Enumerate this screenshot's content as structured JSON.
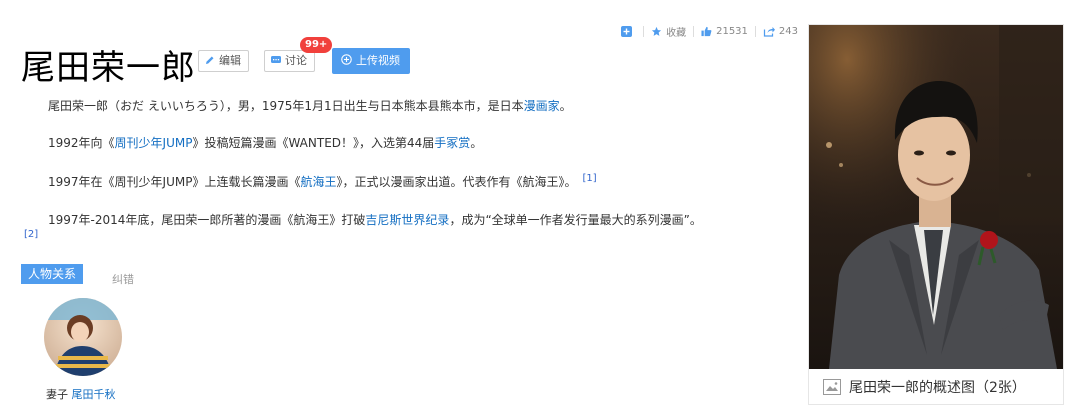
{
  "entry": {
    "title": "尾田荣一郎",
    "edit_label": "编辑",
    "discuss_label": "讨论",
    "discuss_badge": "99+",
    "upload_label": "上传视频"
  },
  "toolbar": {
    "favorite_label": "收藏",
    "likes": "21531",
    "shares": "243"
  },
  "paragraphs": {
    "p1_text": "尾田荣一郎（おだ えいいちろう），男，1975年1月1日出生与日本熊本县熊本市，是日本",
    "p1_link": "漫画家",
    "p1_end": "。",
    "p2_pre": "1992年向《",
    "p2_link1": "周刊少年JUMP",
    "p2_mid": "》投稿短篇漫画《WANTED！》，入选第44届",
    "p2_link2": "手冢赏",
    "p2_end": "。",
    "p3_pre": "1997年在《周刊少年JUMP》上连载长篇漫画《",
    "p3_link": "航海王",
    "p3_end": "》，正式以漫画家出道。代表作有《航海王》。",
    "p3_ref": "[1]",
    "p4_pre": "1997年-2014年底，尾田荣一郎所著的漫画《航海王》打破",
    "p4_link": "吉尼斯世界纪录",
    "p4_end": "，成为“全球单一作者发行量最大的系列漫画”。",
    "p4_ref": "[2]"
  },
  "relations": {
    "tag_label": "人物关系",
    "correct_label": "纠错",
    "items": [
      {
        "relation": "妻子",
        "name": "尾田千秋"
      }
    ]
  },
  "album": {
    "caption": "尾田荣一郎的概述图（2张）"
  },
  "colors": {
    "accent_blue": "#4f9cee",
    "link_blue": "#136ec2",
    "badge_red": "#f1403c"
  }
}
